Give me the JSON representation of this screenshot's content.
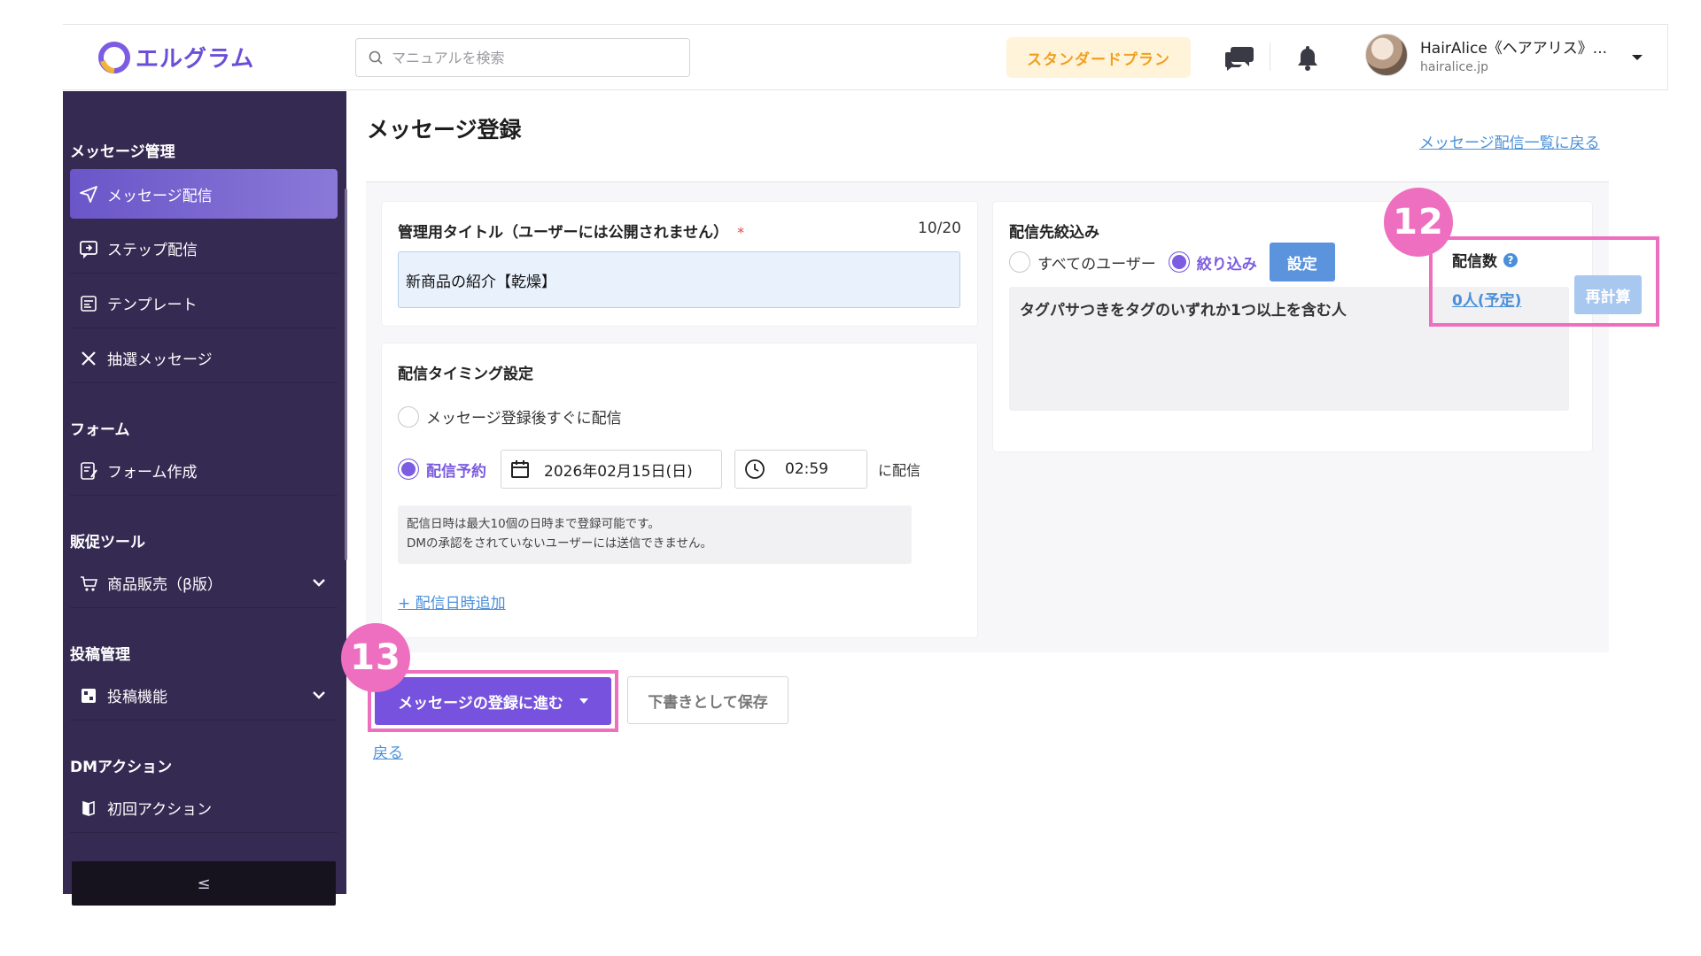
{
  "header": {
    "logo_text": "エルグラム",
    "search_placeholder": "マニュアルを検索",
    "plan_label": "スタンダードプラン",
    "user_name": "HairAlice《ヘアアリス》...",
    "user_domain": "hairalice.jp",
    "icons": [
      "search-icon",
      "chat-icon",
      "bell-icon",
      "chevron-down-icon"
    ]
  },
  "sidebar": {
    "sections": [
      {
        "title": "メッセージ管理"
      },
      {
        "title": "フォーム"
      },
      {
        "title": "販促ツール"
      },
      {
        "title": "投稿管理"
      },
      {
        "title": "DMアクション"
      }
    ],
    "items": [
      {
        "label": "メッセージ配信",
        "icon": "send-icon",
        "active": true
      },
      {
        "label": "ステップ配信",
        "icon": "step-icon"
      },
      {
        "label": "テンプレート",
        "icon": "template-icon"
      },
      {
        "label": "抽選メッセージ",
        "icon": "cross-icon"
      },
      {
        "label": "フォーム作成",
        "icon": "form-icon"
      },
      {
        "label": "商品販売（β版）",
        "icon": "cart-icon"
      },
      {
        "label": "投稿機能",
        "icon": "post-icon"
      },
      {
        "label": "初回アクション",
        "icon": "action-icon"
      }
    ],
    "collapse_label": "≤"
  },
  "main": {
    "page_title": "メッセージ登録",
    "back_to_list": "メッセージ配信一覧に戻る",
    "title_card": {
      "label": "管理用タイトル（ユーザーには公開されません）",
      "required_mark": "*",
      "counter": "10/20",
      "value": "新商品の紹介【乾燥】"
    },
    "timing_card": {
      "label": "配信タイミング設定",
      "option_immediate": "メッセージ登録後すぐに配信",
      "option_scheduled": "配信予約",
      "date_value": "2026年02月15日(日)",
      "time_value": "02:59",
      "suffix": "に配信",
      "note_line1": "配信日時は最大10個の日時まで登録可能です。",
      "note_line2": "DMの承認をされていないユーザーには送信できません。",
      "add_datetime": "+ 配信日時追加"
    },
    "filter_card": {
      "label": "配信先絞込み",
      "option_all": "すべてのユーザー",
      "option_filter": "絞り込み",
      "set_button": "設定",
      "condition_text": "タグパサつきをタグのいずれか1つ以上を含む人"
    },
    "count_panel": {
      "label": "配信数",
      "value": "0人(予定)",
      "recalc_button": "再計算"
    },
    "annotations": {
      "badge_12": "12",
      "badge_13": "13"
    },
    "actions": {
      "submit_label": "メッセージの登録に進む",
      "draft_label": "下書きとして保存",
      "back_label": "戻る"
    }
  },
  "colors": {
    "sidebar_bg": "#352a52",
    "accent_purple": "#7752de",
    "link_blue": "#4a8fd9",
    "highlight_pink": "#ee6fbf",
    "plan_text": "#f0a020"
  }
}
